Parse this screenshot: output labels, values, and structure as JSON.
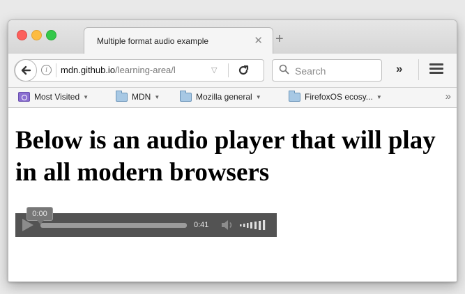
{
  "window": {
    "tab_title": "Multiple format audio example",
    "tab_close": "✕",
    "new_tab": "+"
  },
  "navbar": {
    "url_host": "mdn.github.io",
    "url_path": "/learning-area/l",
    "search_placeholder": "Search",
    "overflow_label": "»"
  },
  "bookmarks": {
    "items": [
      {
        "label": "Most Visited",
        "icon": "most-visited-icon"
      },
      {
        "label": "MDN",
        "icon": "folder-icon"
      },
      {
        "label": "Mozilla general",
        "icon": "folder-icon"
      },
      {
        "label": "FirefoxOS ecosy...",
        "icon": "folder-icon"
      }
    ],
    "overflow_label": "»"
  },
  "page": {
    "heading": "Below is an audio player that will play in all modern browsers"
  },
  "audio_player": {
    "current_time": "0:00",
    "duration": "0:41",
    "progress": 0,
    "volume_level": 1.0
  },
  "colors": {
    "player_bg": "#535353",
    "close_red": "#fc605c",
    "minimize_yellow": "#fdbc40",
    "maximize_green": "#34c84a"
  }
}
